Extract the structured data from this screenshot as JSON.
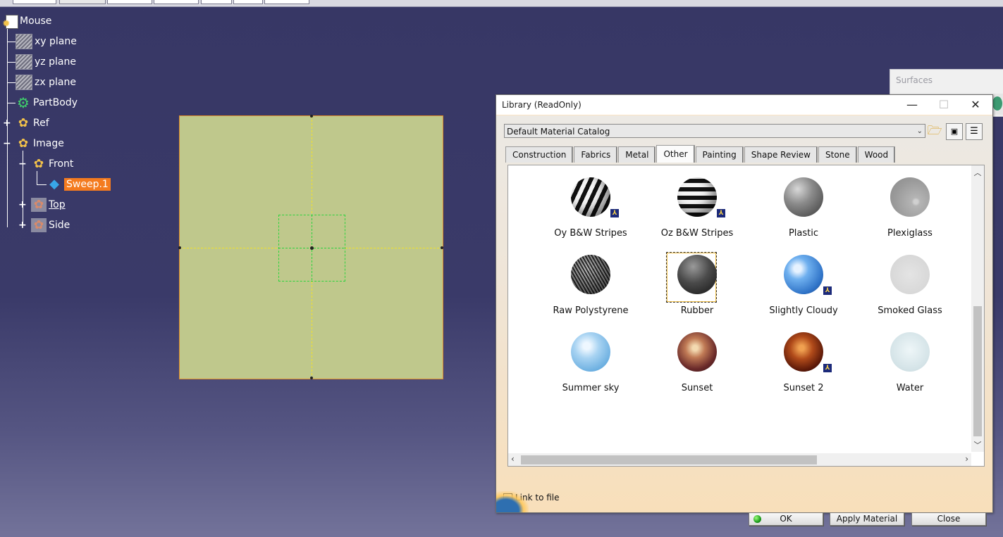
{
  "tree": {
    "root": "Mouse",
    "items": [
      {
        "label": "xy plane",
        "icon": "plane-icon"
      },
      {
        "label": "yz plane",
        "icon": "plane-icon"
      },
      {
        "label": "zx plane",
        "icon": "plane-icon"
      },
      {
        "label": "PartBody",
        "icon": "body-gear-icon"
      },
      {
        "label": "Ref",
        "icon": "geometrical-set-icon"
      },
      {
        "label": "Image",
        "icon": "geometrical-set-icon"
      },
      {
        "label": "Front",
        "icon": "geometrical-set-icon"
      },
      {
        "label": "Sweep.1",
        "icon": "sweep-icon"
      },
      {
        "label": "Top",
        "icon": "hidden-set-icon"
      },
      {
        "label": "Side",
        "icon": "hidden-set-icon"
      }
    ]
  },
  "surfaces_toolbar": {
    "title": "Surfaces"
  },
  "dialog": {
    "title": "Library (ReadOnly)",
    "catalog": "Default Material Catalog",
    "tabs": [
      "Construction",
      "Fabrics",
      "Metal",
      "Other",
      "Painting",
      "Shape Review",
      "Stone",
      "Wood"
    ],
    "active_tab": "Other",
    "materials": [
      {
        "name": "Oy B&W Stripes",
        "badge": true
      },
      {
        "name": "Oz B&W Stripes",
        "badge": true
      },
      {
        "name": "Plastic",
        "badge": false
      },
      {
        "name": "Plexiglass",
        "badge": false
      },
      {
        "name": "Raw Polystyrene",
        "badge": false
      },
      {
        "name": "Rubber",
        "badge": false,
        "selected": true
      },
      {
        "name": "Slightly Cloudy",
        "badge": true
      },
      {
        "name": "Smoked Glass",
        "badge": false
      },
      {
        "name": "Summer sky",
        "badge": false
      },
      {
        "name": "Sunset",
        "badge": false
      },
      {
        "name": "Sunset 2",
        "badge": true
      },
      {
        "name": "Water",
        "badge": false
      }
    ],
    "link_to_file": "Link to file",
    "buttons": {
      "ok": "OK",
      "apply": "Apply Material",
      "close": "Close"
    },
    "window_buttons": {
      "minimize": "—",
      "maximize": "☐",
      "close": "✕"
    },
    "badge_glyph": "⅄"
  }
}
